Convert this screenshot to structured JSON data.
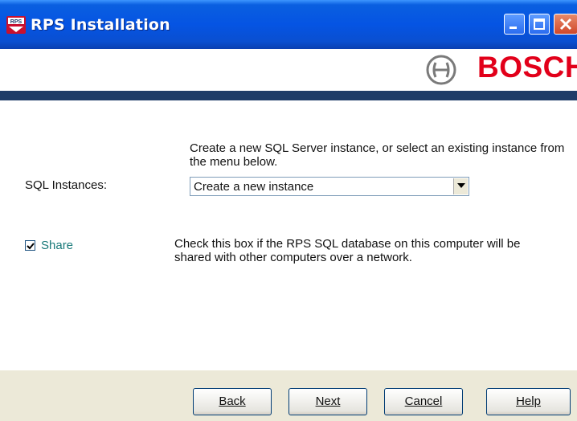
{
  "window": {
    "title": "RPS Installation",
    "icon_name": "rps-app-icon"
  },
  "header": {
    "brand": "BOSCH",
    "accent_color": "#e2001a",
    "bar_color": "#1f3c68"
  },
  "content": {
    "instance_description": "Create a new SQL Server instance, or select an existing instance from the menu below.",
    "sql_instances_label": "SQL Instances:",
    "instance_select": {
      "value": "Create a new instance"
    },
    "share": {
      "checked": true,
      "label": "Share",
      "description": "Check this box if the RPS SQL database on this computer will be shared with other computers over a network."
    }
  },
  "buttons": {
    "back": "Back",
    "next": "Next",
    "cancel": "Cancel",
    "help": "Help"
  }
}
